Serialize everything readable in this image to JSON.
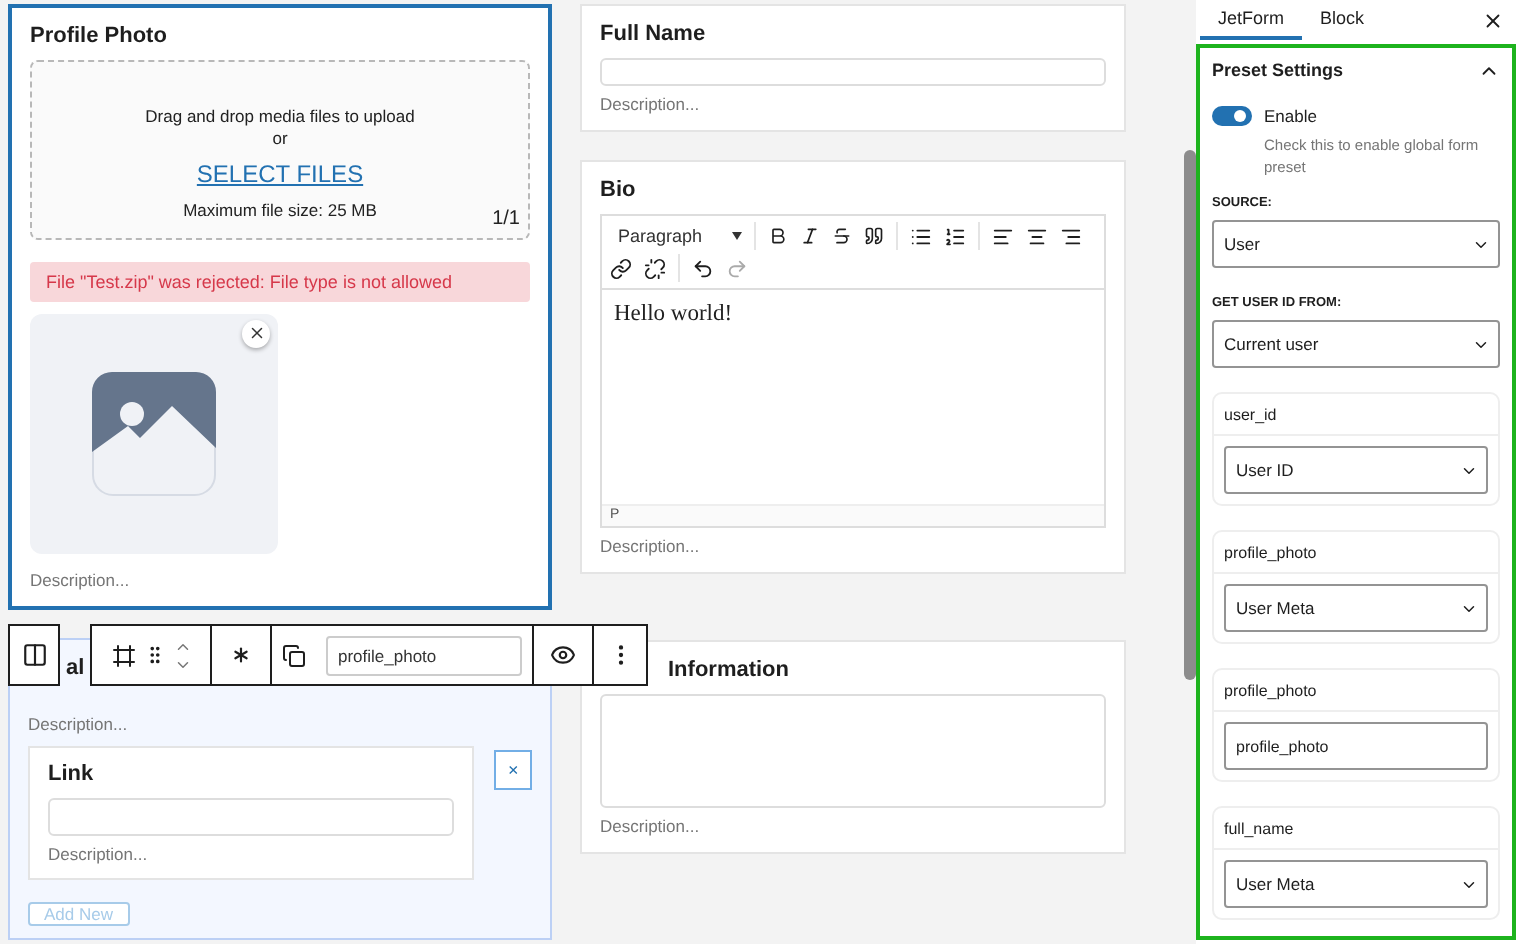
{
  "profile_photo": {
    "label": "Profile Photo",
    "instruction": "Drag and drop media files to upload",
    "or": "or",
    "select": "SELECT FILES",
    "max_size": "Maximum file size: 25 MB",
    "count": "1/1",
    "error": "File \"Test.zip\" was rejected: File type is not allowed",
    "description": "Description..."
  },
  "repeater": {
    "label": "al",
    "description": "Description...",
    "item": {
      "label": "Link",
      "description": "Description..."
    },
    "remove": "×",
    "add_button": {
      "label": "Add New",
      "disabled": true
    }
  },
  "block_toolbar": {
    "field_name": "profile_photo"
  },
  "full_name": {
    "label": "Full Name",
    "description": "Description..."
  },
  "bio": {
    "label": "Bio",
    "format": "Paragraph",
    "content": "Hello world!",
    "path": "P",
    "description": "Description..."
  },
  "info": {
    "label": "Information",
    "description": "Description..."
  },
  "sidebar": {
    "tabs": [
      {
        "label": "JetForm",
        "selected": true
      },
      {
        "label": "Block",
        "selected": false
      }
    ],
    "panel": {
      "title": "Preset Settings",
      "expanded": true,
      "enable": {
        "label": "Enable",
        "on": true,
        "help": "Check this to enable global form preset"
      },
      "source": {
        "label": "SOURCE:",
        "value": "User"
      },
      "user_id_from": {
        "label": "GET USER ID FROM:",
        "value": "Current user"
      },
      "fields": [
        {
          "name": "user_id",
          "kind": "select",
          "value": "User ID"
        },
        {
          "name": "profile_photo",
          "kind": "select",
          "value": "User Meta"
        },
        {
          "name": "profile_photo",
          "kind": "input",
          "value": "profile_photo"
        },
        {
          "name": "full_name",
          "kind": "select",
          "value": "User Meta"
        }
      ]
    }
  }
}
